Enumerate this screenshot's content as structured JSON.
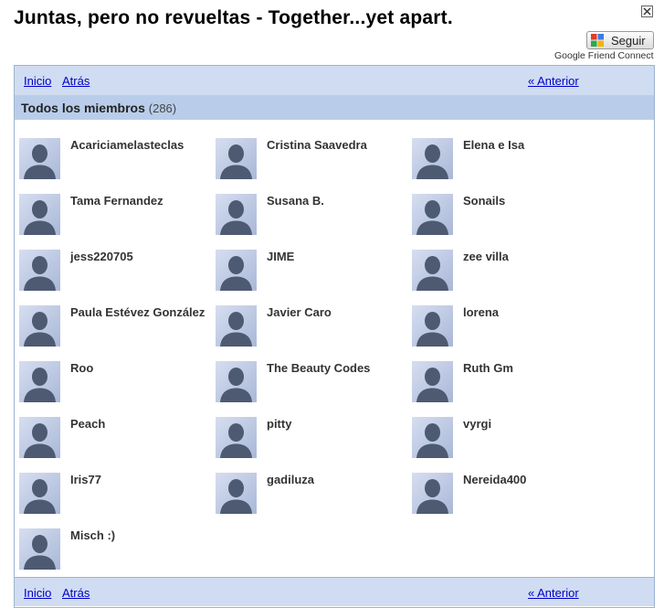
{
  "page": {
    "title": "Juntas, pero no revueltas - Together...yet apart.",
    "close_label": "✕",
    "follow_label": "Seguir",
    "provider_label": "Google Friend Connect"
  },
  "nav": {
    "home_label": "Inicio",
    "back_label": "Atrás",
    "prev_label": "« Anterior"
  },
  "section": {
    "title": "Todos los miembros",
    "count": "(286)"
  },
  "members": [
    "Acariciamelasteclas",
    "Cristina Saavedra",
    "Elena e Isa",
    "Tama Fernandez",
    "Susana B.",
    "Sonails",
    "jess220705",
    "JIME",
    "zee villa",
    "Paula Estévez González",
    "Javier Caro",
    "lorena",
    "Roo",
    "The Beauty Codes",
    "Ruth Gm",
    "Peach",
    "pitty",
    "vyrgi",
    "Iris77",
    "gadiluza",
    "Nereida400",
    "Misch :)"
  ],
  "colors": {
    "nav_bar": "#cfdcf1",
    "section_bar": "#b9cdea",
    "link": "#0000cc",
    "border": "#9fb3cf"
  },
  "icons": {
    "avatar": "default-avatar-icon",
    "google": "google-logo-icon",
    "close": "close-icon"
  }
}
